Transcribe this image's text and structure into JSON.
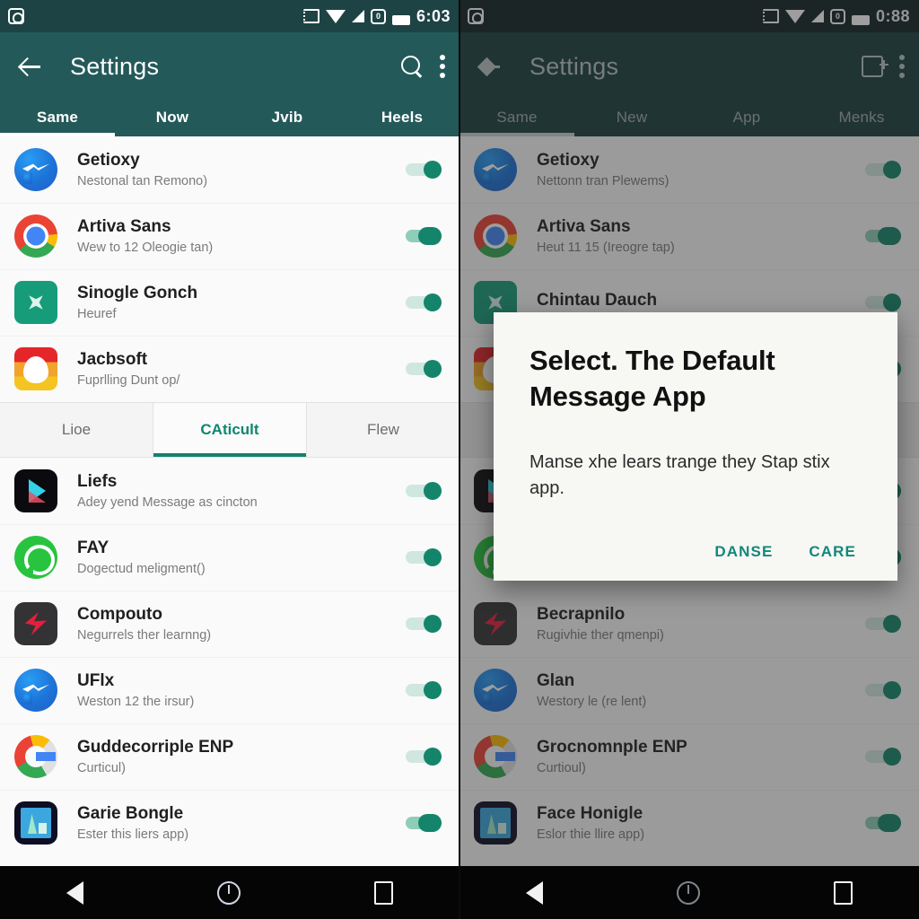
{
  "left": {
    "status_bar": {
      "left_icon": "headset-icon",
      "icons": [
        "cast-icon",
        "wifi-icon",
        "signal-icon",
        "alarm-icon",
        "battery-icon"
      ],
      "time": "6:03"
    },
    "appbar": {
      "back_icon": "back-arrow-icon",
      "title": "Settings",
      "search_icon": "search-icon",
      "overflow_icon": "kebab-menu-icon"
    },
    "tabs": [
      {
        "label": "Same",
        "selected": true
      },
      {
        "label": "Now",
        "selected": false
      },
      {
        "label": "Jvib",
        "selected": false
      },
      {
        "label": "Heels",
        "selected": false
      }
    ],
    "top_list": [
      {
        "icon": "messenger-icon",
        "title": "Getioxy",
        "subtitle": "Nestonal tan Remono)",
        "toggle": "on"
      },
      {
        "icon": "chrome-icon",
        "title": "Artiva Sans",
        "subtitle": "Wew to 12 Oleogie tan)",
        "toggle": "on-wide"
      },
      {
        "icon": "green-diamond-icon",
        "title": "Sinogle Gonch",
        "subtitle": "Heuref",
        "toggle": "on"
      },
      {
        "icon": "snapchat-icon",
        "title": "Jacbsoft",
        "subtitle": "Fuprlling Dunt op/",
        "toggle": "on"
      }
    ],
    "sub_tabs": [
      {
        "label": "Lioe",
        "selected": false
      },
      {
        "label": "CAticult",
        "selected": true
      },
      {
        "label": "Flew",
        "selected": false
      }
    ],
    "bottom_list": [
      {
        "icon": "play-store-icon",
        "title": "Liefs",
        "subtitle": "Adey yend Message as cincton",
        "toggle": "on"
      },
      {
        "icon": "whatsapp-icon",
        "title": "FAY",
        "subtitle": "Dogectud meligment()",
        "toggle": "on"
      },
      {
        "icon": "bolt-icon",
        "title": "Compouto",
        "subtitle": "Negurrels ther learnng)",
        "toggle": "on"
      },
      {
        "icon": "messenger-icon",
        "title": "UFlx",
        "subtitle": "Weston 12 the irsur)",
        "toggle": "on"
      },
      {
        "icon": "google-icon",
        "title": "Guddecorriple ENP",
        "subtitle": "Curticul)",
        "toggle": "on"
      },
      {
        "icon": "chart-icon",
        "title": "Garie Bongle",
        "subtitle": "Ester this liers app)",
        "toggle": "on-wide"
      }
    ],
    "navbar": {
      "back": "nav-back-icon",
      "home": "nav-home-icon",
      "recents": "nav-recents-icon"
    }
  },
  "right": {
    "status_bar": {
      "left_icon": "headset-icon",
      "icons": [
        "cast-icon",
        "wifi-icon",
        "signal-icon",
        "alarm-icon",
        "battery-icon"
      ],
      "time": "0:88"
    },
    "appbar": {
      "back_icon": "back-arrow-icon",
      "title": "Settings",
      "add_icon": "add-box-icon",
      "overflow_icon": "kebab-menu-icon"
    },
    "tabs": [
      {
        "label": "Same",
        "selected": true
      },
      {
        "label": "New",
        "selected": false
      },
      {
        "label": "App",
        "selected": false
      },
      {
        "label": "Menks",
        "selected": false
      }
    ],
    "top_list": [
      {
        "icon": "messenger-icon",
        "title": "Getioxy",
        "subtitle": "Nettonn tran Plewems)",
        "toggle": "on"
      },
      {
        "icon": "chrome-icon",
        "title": "Artiva Sans",
        "subtitle": "Heut 11 15 (Ireogre tap)",
        "toggle": "on-wide"
      },
      {
        "icon": "green-diamond-icon",
        "title": "Chintau Dauch",
        "subtitle": "",
        "toggle": "on"
      },
      {
        "icon": "snapchat-icon",
        "title": "",
        "subtitle": "",
        "toggle": "on"
      }
    ],
    "hidden_list": [
      {
        "icon": "play-store-icon",
        "title": "",
        "subtitle": "",
        "toggle": "on"
      },
      {
        "icon": "whatsapp-icon",
        "title": "",
        "subtitle": "",
        "toggle": "on"
      }
    ],
    "bottom_list": [
      {
        "icon": "bolt-icon",
        "title": "Becrapnilo",
        "subtitle": "Rugivhie ther qmenpi)",
        "toggle": "on"
      },
      {
        "icon": "messenger-icon",
        "title": "Glan",
        "subtitle": "Westory le (re lent)",
        "toggle": "on"
      },
      {
        "icon": "google-icon",
        "title": "Grocnomnple ENP",
        "subtitle": "Curtioul)",
        "toggle": "on"
      },
      {
        "icon": "chart-icon",
        "title": "Face Honigle",
        "subtitle": "Eslor thie llire app)",
        "toggle": "on-wide"
      }
    ],
    "dialog": {
      "title": "Select. The Default Message App",
      "body": "Manse xhe lears trange they Stap stix app.",
      "buttons": [
        {
          "label": "DANSE"
        },
        {
          "label": "CARE"
        }
      ]
    },
    "navbar": {
      "back": "nav-back-icon",
      "home": "nav-home-icon",
      "recents": "nav-recents-icon"
    }
  },
  "colors": {
    "status_bar": "#1e4344",
    "app_bar": "#24595a",
    "accent": "#12836c",
    "toggle_thumb": "#14856b",
    "toggle_track": "#cfe7e0",
    "dialog_bg": "#f7f7f4",
    "list_bg": "#fafafa",
    "nav_bar": "#050505"
  }
}
